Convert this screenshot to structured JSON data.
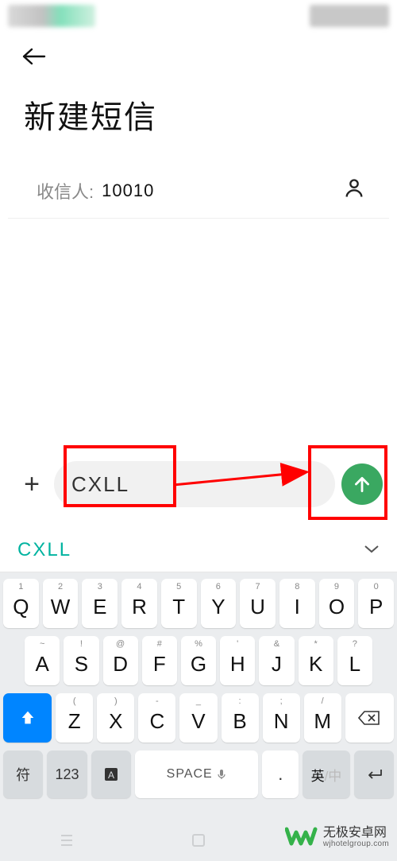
{
  "header": {
    "title": "新建短信"
  },
  "recipient": {
    "label": "收信人:",
    "value": "10010"
  },
  "compose": {
    "message": "CXLL"
  },
  "keyboard": {
    "suggestion": "CXLL",
    "row1": [
      {
        "sup": "1",
        "main": "Q"
      },
      {
        "sup": "2",
        "main": "W"
      },
      {
        "sup": "3",
        "main": "E"
      },
      {
        "sup": "4",
        "main": "R"
      },
      {
        "sup": "5",
        "main": "T"
      },
      {
        "sup": "6",
        "main": "Y"
      },
      {
        "sup": "7",
        "main": "U"
      },
      {
        "sup": "8",
        "main": "I"
      },
      {
        "sup": "9",
        "main": "O"
      },
      {
        "sup": "0",
        "main": "P"
      }
    ],
    "row2": [
      {
        "sup": "~",
        "main": "A"
      },
      {
        "sup": "!",
        "main": "S"
      },
      {
        "sup": "@",
        "main": "D"
      },
      {
        "sup": "#",
        "main": "F"
      },
      {
        "sup": "%",
        "main": "G"
      },
      {
        "sup": "'",
        "main": "H"
      },
      {
        "sup": "&",
        "main": "J"
      },
      {
        "sup": "*",
        "main": "K"
      },
      {
        "sup": "?",
        "main": "L"
      }
    ],
    "row3": [
      {
        "sup": "(",
        "main": "Z"
      },
      {
        "sup": ")",
        "main": "X"
      },
      {
        "sup": "-",
        "main": "C"
      },
      {
        "sup": "_",
        "main": "V"
      },
      {
        "sup": ":",
        "main": "B"
      },
      {
        "sup": ";",
        "main": "N"
      },
      {
        "sup": "/",
        "main": "M"
      }
    ],
    "bottom": {
      "sym": "符",
      "num": "123",
      "space": "SPACE",
      "period": ".",
      "lang_active": "英",
      "lang_inactive": "/中"
    }
  },
  "watermark": {
    "name": "无极安卓网",
    "url": "wjhotelgroup.com"
  }
}
